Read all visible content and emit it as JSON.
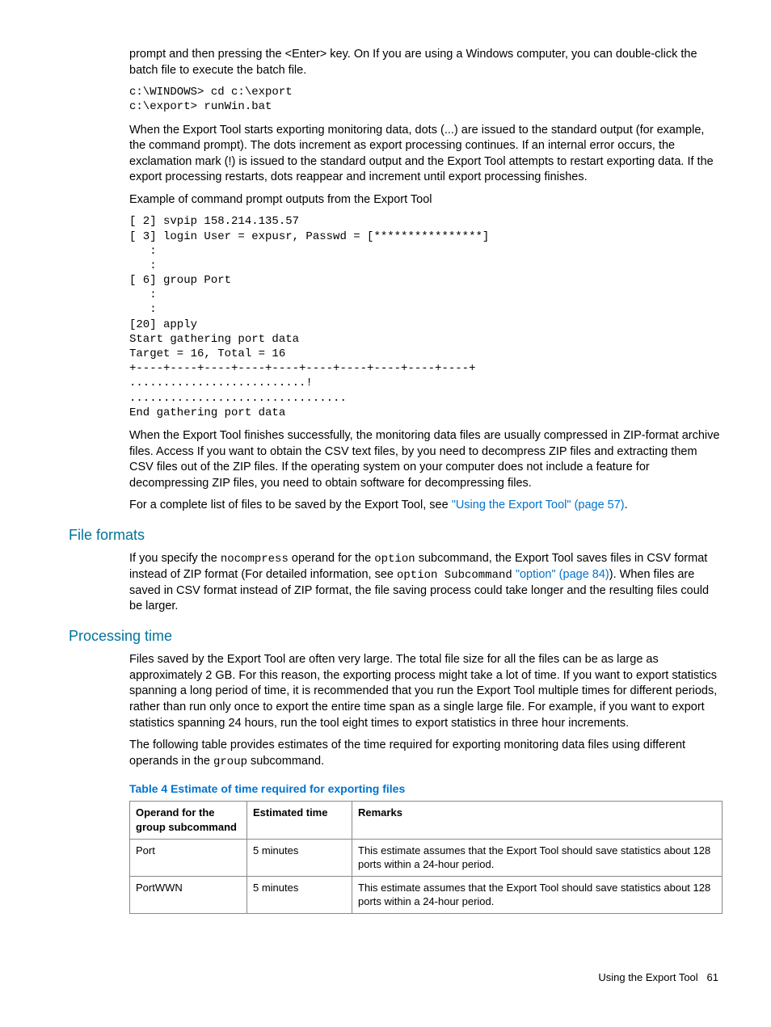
{
  "intro": {
    "p1": "prompt and then pressing the <Enter> key. On If you are using a Windows computer, you can double-click the batch file to execute the batch file.",
    "code1": "c:\\WINDOWS> cd c:\\export\nc:\\export> runWin.bat",
    "p2": "When the Export Tool starts exporting monitoring data, dots (...) are issued to the standard output (for example, the command prompt). The dots increment as export processing continues. If an internal error occurs, the exclamation mark (!) is issued to the standard output and the Export Tool attempts to restart exporting data. If the export processing restarts, dots reappear and increment until export processing finishes.",
    "p3": "Example of command prompt outputs from the Export Tool",
    "code2": "[ 2] svpip 158.214.135.57\n[ 3] login User = expusr, Passwd = [****************]\n   :\n   :\n[ 6] group Port\n   :\n   :\n[20] apply\nStart gathering port data\nTarget = 16, Total = 16\n+----+----+----+----+----+----+----+----+----+----+\n..........................!\n................................\nEnd gathering port data",
    "p4": "When the Export Tool finishes successfully, the monitoring data files are usually compressed in ZIP-format archive files. Access If you want to obtain the CSV text files, by you need to decompress ZIP files and extracting them CSV files out of the ZIP files. If the operating system on your computer does not include a feature for decompressing ZIP files, you need to obtain software for decompressing files.",
    "p5_pre": "For a complete list of files to be saved by the Export Tool, see ",
    "p5_link": "\"Using the Export Tool\" (page 57)",
    "p5_post": "."
  },
  "file_formats": {
    "heading": "File formats",
    "p1_a": "If you specify the ",
    "p1_code1": "nocompress",
    "p1_b": " operand for the ",
    "p1_code2": "option",
    "p1_c": " subcommand, the Export Tool saves files in CSV format instead of ZIP format (For detailed information, see ",
    "p1_code3": "option Subcommand",
    "p1_link": " \"option\" (page 84)",
    "p1_d": "). When files are saved in CSV format instead of ZIP format, the file saving process could take longer and the resulting files could be larger."
  },
  "processing_time": {
    "heading": "Processing time",
    "p1": "Files saved by the Export Tool are often very large. The total file size for all the files can be as large as approximately 2 GB. For this reason, the exporting process might take a lot of time. If you want to export statistics spanning a long period of time, it is recommended that you run the Export Tool multiple times for different periods, rather than run only once to export the entire time span as a single large file. For example, if you want to export statistics spanning 24 hours, run the tool eight times to export statistics in three hour increments.",
    "p2_a": "The following table provides estimates of the time required for exporting monitoring data files using different operands in the ",
    "p2_code": "group",
    "p2_b": " subcommand."
  },
  "table": {
    "title": "Table 4 Estimate of time required for exporting files",
    "headers": {
      "h1": "Operand for the group subcommand",
      "h2": "Estimated time",
      "h3": "Remarks"
    },
    "rows": [
      {
        "c1": "Port",
        "c2": "5 minutes",
        "c3": "This estimate assumes that the Export Tool should save statistics about 128 ports within a 24-hour period."
      },
      {
        "c1": "PortWWN",
        "c2": "5 minutes",
        "c3": "This estimate assumes that the Export Tool should save statistics about 128 ports within a 24-hour period."
      }
    ]
  },
  "footer": {
    "text": "Using the Export Tool",
    "page": "61"
  }
}
